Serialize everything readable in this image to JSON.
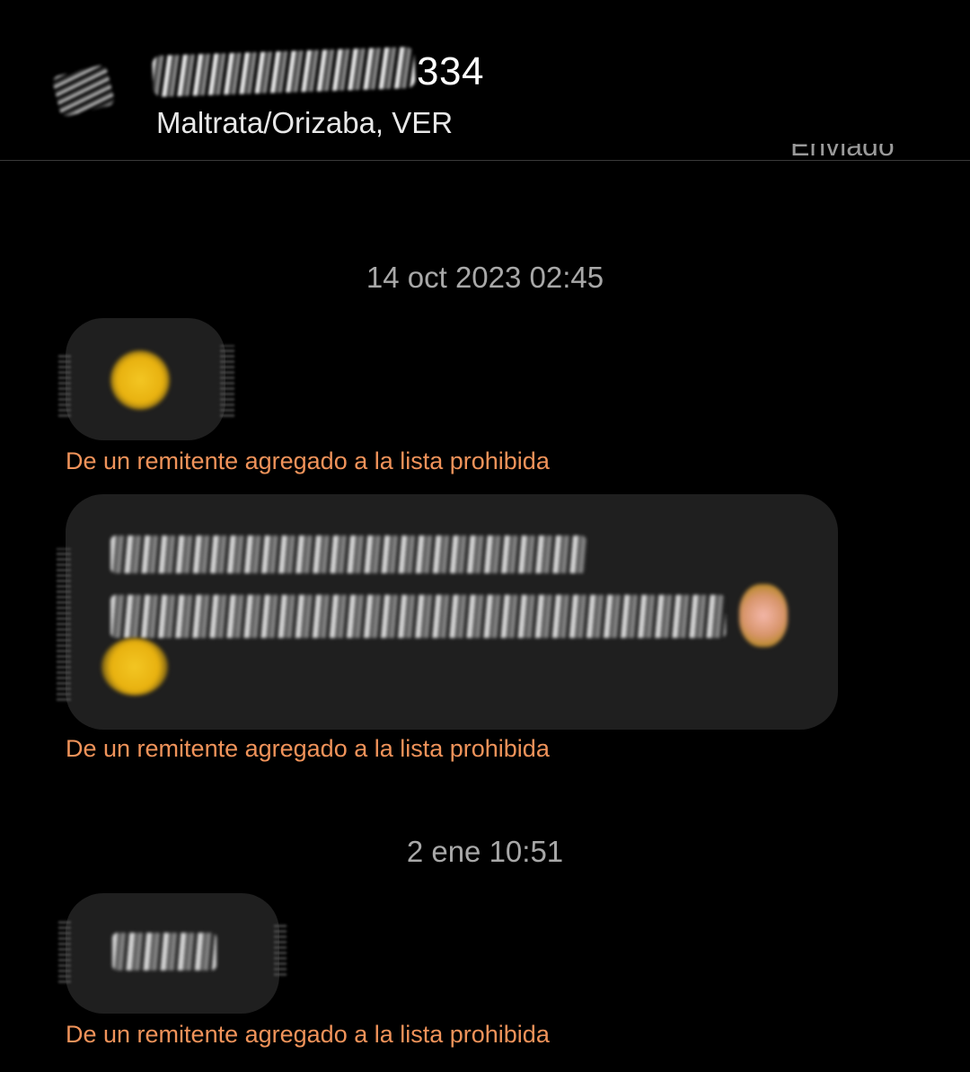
{
  "header": {
    "title_visible_suffix": "334",
    "subtitle": "Maltrata/Orizaba, VER"
  },
  "conversation": {
    "status_label": "Enviado",
    "messages_groups": [
      {
        "timestamp": "14 oct 2023 02:45",
        "messages": [
          {
            "content": "redacted",
            "note": "De un remitente agregado a la lista prohibida"
          },
          {
            "content": "redacted",
            "note": "De un remitente agregado a la lista prohibida"
          }
        ]
      },
      {
        "timestamp": "2 ene 10:51",
        "messages": [
          {
            "content": "redacted",
            "note": "De un remitente agregado a la lista prohibida"
          }
        ]
      }
    ]
  },
  "colors": {
    "background": "#000000",
    "bubble": "#1f1f1f",
    "note_orange": "#f0935a",
    "timestamp_gray": "#a8a8a8"
  }
}
